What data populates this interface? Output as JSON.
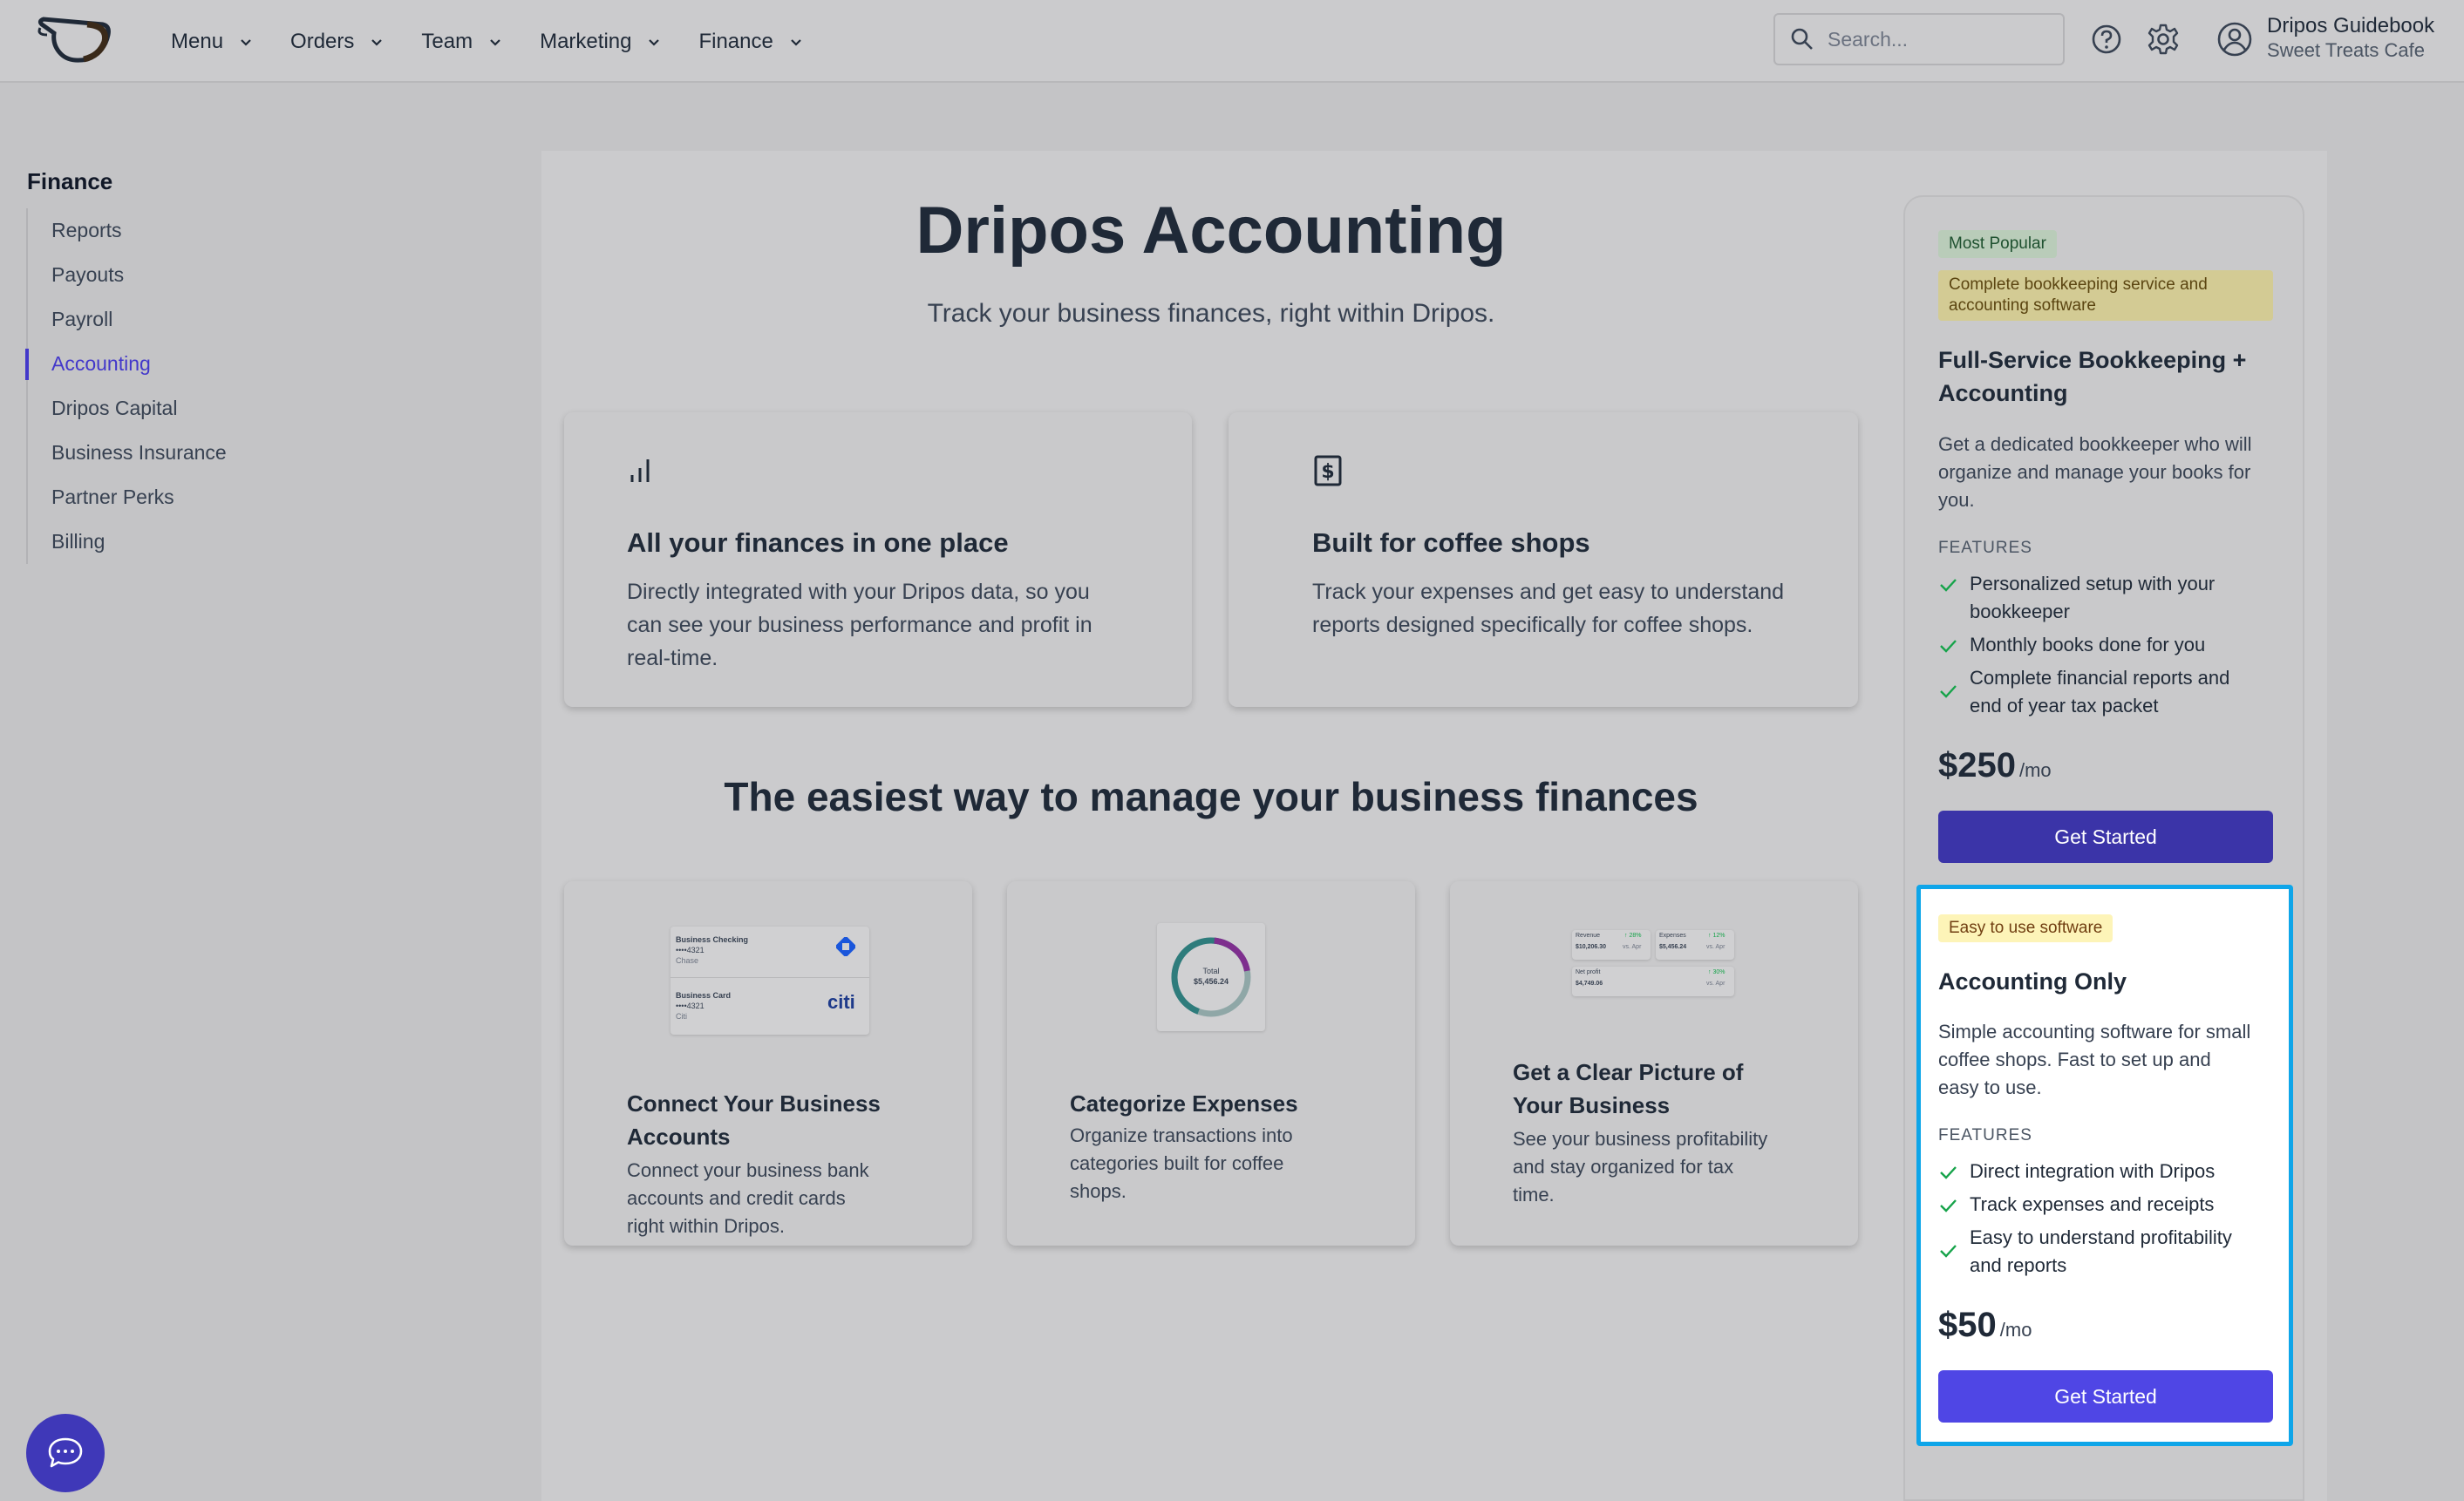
{
  "nav": {
    "menus": [
      "Menu",
      "Orders",
      "Team",
      "Marketing",
      "Finance"
    ],
    "search_placeholder": "Search...",
    "user_name": "Dripos Guidebook",
    "business_name": "Sweet Treats Cafe"
  },
  "sidebar": {
    "title": "Finance",
    "items": [
      {
        "label": "Reports",
        "active": false
      },
      {
        "label": "Payouts",
        "active": false
      },
      {
        "label": "Payroll",
        "active": false
      },
      {
        "label": "Accounting",
        "active": true
      },
      {
        "label": "Dripos Capital",
        "active": false
      },
      {
        "label": "Business Insurance",
        "active": false
      },
      {
        "label": "Partner Perks",
        "active": false
      },
      {
        "label": "Billing",
        "active": false
      }
    ]
  },
  "hero": {
    "title": "Dripos Accounting",
    "subtitle": "Track your business finances, right within Dripos."
  },
  "benefits": [
    {
      "icon": "bar-chart-icon",
      "title": "All your finances in one place",
      "lines": [
        "Directly integrated with your Dripos data, so you",
        "can see your business performance and profit in",
        "real-time."
      ]
    },
    {
      "icon": "receipt-dollar-icon",
      "title": "Built for coffee shops",
      "lines": [
        "Track your expenses and get easy to understand",
        "reports designed specifically for coffee shops."
      ]
    }
  ],
  "features_heading": "The easiest way to manage your business finances",
  "features": [
    {
      "title_lines": [
        "Connect Your Business",
        "Accounts"
      ],
      "lines": [
        "Connect your business bank",
        "accounts and credit cards",
        "right within Dripos."
      ],
      "illustration": {
        "account1_name": "Business Checking",
        "account1_number": "••••4321",
        "account1_bank": "Chase",
        "account2_name": "Business Card",
        "account2_number": "••••4321",
        "account2_bank": "Citi",
        "citi_logo": "citi"
      }
    },
    {
      "title_lines": [
        "Categorize Expenses"
      ],
      "lines": [
        "Organize transactions into",
        "categories built for coffee",
        "shops."
      ],
      "illustration": {
        "donut_label": "Total",
        "donut_value": "$5,456.24"
      }
    },
    {
      "title_lines": [
        "Get a Clear Picture of",
        "Your Business"
      ],
      "lines": [
        "See your business profitability",
        "and stay organized for tax",
        "time."
      ],
      "illustration": {
        "revenue_label": "Revenue",
        "revenue_change": "↑ 28%",
        "revenue_value": "$10,206.30",
        "revenue_compare": "vs. Apr",
        "expenses_label": "Expenses",
        "expenses_change": "↑ 12%",
        "expenses_value": "$5,456.24",
        "expenses_compare": "vs. Apr",
        "net_label": "Net profit",
        "net_change": "↑ 30%",
        "net_value": "$4,749.06",
        "net_compare": "vs. Apr"
      }
    }
  ],
  "plans": [
    {
      "badge": "Most Popular",
      "badge2_lines": [
        "Complete bookkeeping service and",
        "accounting software"
      ],
      "title_lines": [
        "Full-Service Bookkeeping +",
        "Accounting"
      ],
      "desc_lines": [
        "Get a dedicated bookkeeper who will",
        "organize and manage your books for",
        "you."
      ],
      "features_label": "FEATURES",
      "features": [
        [
          "Personalized setup with your",
          "bookkeeper"
        ],
        [
          "Monthly books done for you"
        ],
        [
          "Complete financial reports and",
          "end of year tax packet"
        ]
      ],
      "price": "$250",
      "per": "/mo",
      "cta": "Get Started"
    },
    {
      "badge": "Easy to use software",
      "title_lines": [
        "Accounting Only"
      ],
      "desc_lines": [
        "Simple accounting software for small",
        "coffee shops. Fast to set up and",
        "easy to use."
      ],
      "features_label": "FEATURES",
      "features": [
        [
          "Direct integration with Dripos"
        ],
        [
          "Track expenses and receipts"
        ],
        [
          "Easy to understand profitability",
          "and reports"
        ]
      ],
      "price": "$50",
      "per": "/mo",
      "cta": "Get Started"
    }
  ],
  "colors": {
    "accent": "#4f46e5",
    "highlight_border": "#0ea5e9",
    "check": "#16a34a"
  }
}
